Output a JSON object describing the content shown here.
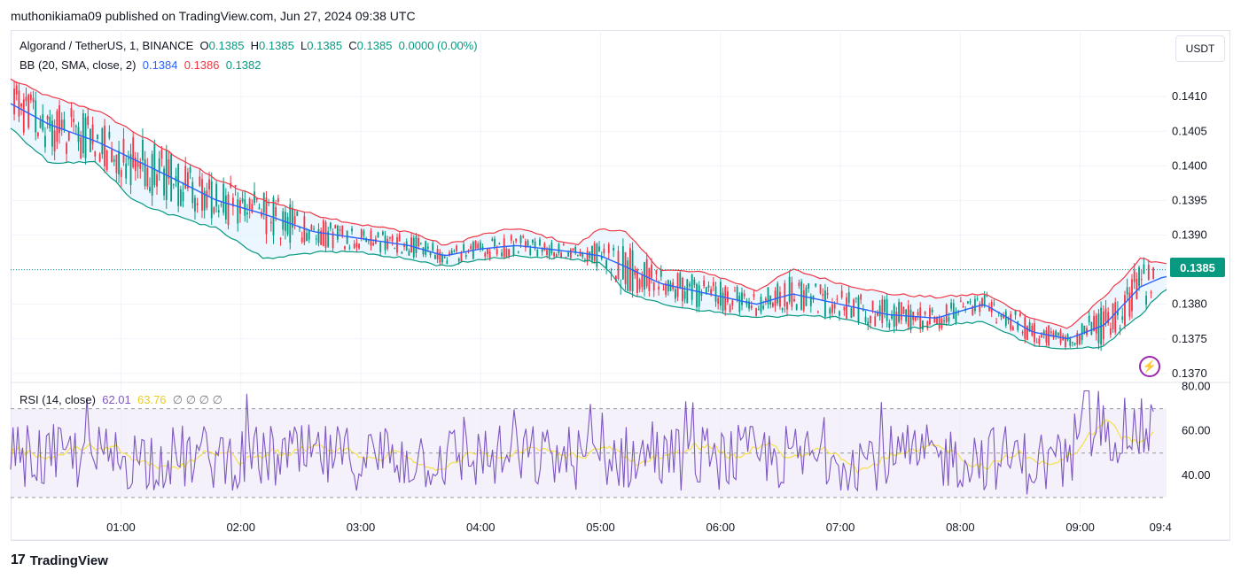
{
  "header": {
    "published": "muthonikiama09 published on TradingView.com, Jun 27, 2024 09:38 UTC"
  },
  "legend": {
    "symbol": "Algorand / TetherUS, 1, BINANCE",
    "o_label": "O",
    "o": "0.1385",
    "h_label": "H",
    "h": "0.1385",
    "l_label": "L",
    "l": "0.1385",
    "c_label": "C",
    "c": "0.1385",
    "change": "0.0000 (0.00%)",
    "bb_label": "BB (20, SMA, close, 2)",
    "bb_basis": "0.1384",
    "bb_upper": "0.1386",
    "bb_lower": "0.1382",
    "rsi_label": "RSI (14, close)",
    "rsi_value": "62.01",
    "rsi_ma": "63.76",
    "rsi_na": "∅ ∅ ∅ ∅"
  },
  "currency_button": "USDT",
  "last_price": "0.1385",
  "footer": {
    "brand": "TradingView",
    "logo": "17"
  },
  "colors": {
    "up": "#089981",
    "down": "#f23645",
    "bb_basis": "#2962ff",
    "bb_upper": "#f23645",
    "bb_lower": "#089981",
    "bb_fill": "#e3f2fd",
    "rsi": "#7e57c2",
    "rsi_ma": "#f5e04b",
    "rsi_band": "#ede7f6"
  },
  "chart_data": [
    {
      "type": "candlestick",
      "title": "Algorand / TetherUS, 1, BINANCE",
      "x_ticks": [
        "01:00",
        "02:00",
        "03:00",
        "04:00",
        "05:00",
        "06:00",
        "07:00",
        "08:00",
        "09:00",
        "09:4"
      ],
      "x_tick_hours": [
        1,
        2,
        3,
        4,
        5,
        6,
        7,
        8,
        9,
        9.67
      ],
      "x_range": [
        0.08,
        9.72
      ],
      "y_ticks": [
        "0.1410",
        "0.1405",
        "0.1400",
        "0.1395",
        "0.1390",
        "0.1385",
        "0.1380",
        "0.1375",
        "0.1370"
      ],
      "ylim": [
        0.13687,
        0.14145
      ],
      "last_price": 0.1385,
      "bb_anchors": [
        [
          0.08,
          0.1409,
          0.14125,
          0.14055
        ],
        [
          0.4,
          0.1406,
          0.141,
          0.14005
        ],
        [
          0.8,
          0.14035,
          0.1408,
          0.14005
        ],
        [
          1.1,
          0.1401,
          0.1405,
          0.1395
        ],
        [
          1.4,
          0.13985,
          0.1402,
          0.1393
        ],
        [
          1.8,
          0.1395,
          0.1398,
          0.1391
        ],
        [
          2.2,
          0.1393,
          0.1395,
          0.13865
        ],
        [
          2.6,
          0.13905,
          0.1393,
          0.13875
        ],
        [
          3.0,
          0.13895,
          0.13915,
          0.13875
        ],
        [
          3.4,
          0.13885,
          0.13905,
          0.13865
        ],
        [
          3.7,
          0.1387,
          0.13885,
          0.13855
        ],
        [
          4.0,
          0.1388,
          0.139,
          0.13865
        ],
        [
          4.3,
          0.13885,
          0.1391,
          0.1387
        ],
        [
          4.8,
          0.13875,
          0.13885,
          0.13865
        ],
        [
          5.0,
          0.1387,
          0.1391,
          0.1386
        ],
        [
          5.2,
          0.13855,
          0.13905,
          0.1382
        ],
        [
          5.5,
          0.1383,
          0.1385,
          0.138
        ],
        [
          5.9,
          0.13815,
          0.13845,
          0.1379
        ],
        [
          6.3,
          0.138,
          0.1382,
          0.1378
        ],
        [
          6.6,
          0.13815,
          0.1385,
          0.13785
        ],
        [
          7.0,
          0.138,
          0.1383,
          0.1378
        ],
        [
          7.4,
          0.13785,
          0.13815,
          0.1376
        ],
        [
          7.8,
          0.1378,
          0.1381,
          0.1377
        ],
        [
          8.2,
          0.138,
          0.13815,
          0.13775
        ],
        [
          8.6,
          0.1376,
          0.1378,
          0.1374
        ],
        [
          8.9,
          0.1375,
          0.13765,
          0.13735
        ],
        [
          9.2,
          0.1377,
          0.1381,
          0.1374
        ],
        [
          9.5,
          0.13825,
          0.13865,
          0.13785
        ],
        [
          9.7,
          0.1384,
          0.1386,
          0.1382
        ]
      ]
    },
    {
      "type": "line",
      "title": "RSI (14, close)",
      "y_ticks": [
        "80.00",
        "60.00",
        "40.00"
      ],
      "ylim": [
        26,
        81
      ],
      "bands": [
        70,
        50,
        30
      ],
      "last_rsi": 62.01,
      "last_ma": 63.76
    }
  ]
}
